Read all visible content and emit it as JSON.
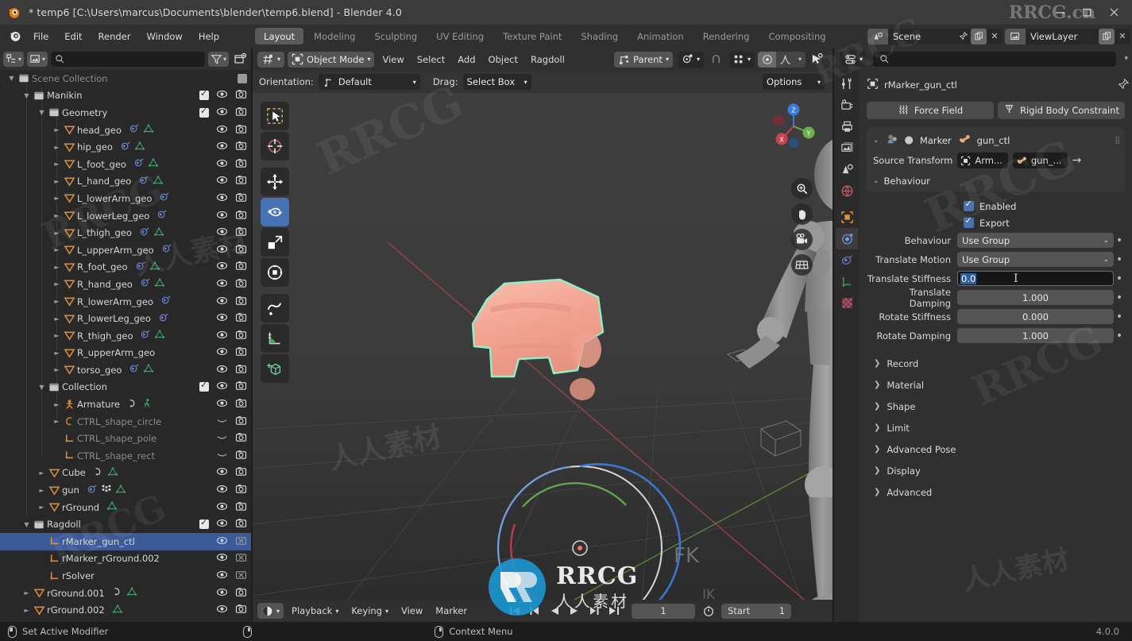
{
  "window": {
    "title": "* temp6 [C:\\Users\\marcus\\Documents\\blender\\temp6.blend] - Blender 4.0",
    "minimize": "–",
    "maximize": "□",
    "close": "✕"
  },
  "menubar": {
    "items": [
      "File",
      "Edit",
      "Render",
      "Window",
      "Help"
    ],
    "workspaces": [
      {
        "label": "Layout",
        "active": true
      },
      {
        "label": "Modeling",
        "active": false
      },
      {
        "label": "Sculpting",
        "active": false
      },
      {
        "label": "UV Editing",
        "active": false
      },
      {
        "label": "Texture Paint",
        "active": false
      },
      {
        "label": "Shading",
        "active": false
      },
      {
        "label": "Animation",
        "active": false
      },
      {
        "label": "Rendering",
        "active": false
      },
      {
        "label": "Compositing",
        "active": false
      }
    ],
    "scene_name": "Scene",
    "viewlayer_name": "ViewLayer"
  },
  "outliner": {
    "display_mode": "view-layer-icon",
    "filter_icon": "filter-icon",
    "new_collection_icon": "new-collection-icon",
    "search_placeholder": "",
    "rows": [
      {
        "label": "Scene Collection",
        "indent": 0,
        "icon": "collection",
        "tri": "down",
        "dim": true,
        "check": false,
        "eye": false,
        "cam": false,
        "partial": true
      },
      {
        "label": "Manikin",
        "indent": 1,
        "icon": "collection",
        "tri": "down",
        "check": true,
        "eye": true,
        "cam": true
      },
      {
        "label": "Geometry",
        "indent": 2,
        "icon": "collection",
        "tri": "down",
        "check": true,
        "eye": true,
        "cam": true
      },
      {
        "label": "head_geo",
        "indent": 3,
        "icon": "mesh",
        "tri": "right",
        "mods": [
          "modifier",
          "mesh-data"
        ],
        "eye": true,
        "cam": true
      },
      {
        "label": "hip_geo",
        "indent": 3,
        "icon": "mesh",
        "tri": "right",
        "mods": [
          "modifier",
          "mesh-data"
        ],
        "eye": true,
        "cam": true
      },
      {
        "label": "L_foot_geo",
        "indent": 3,
        "icon": "mesh",
        "tri": "right",
        "mods": [
          "modifier",
          "mesh-data"
        ],
        "eye": true,
        "cam": true
      },
      {
        "label": "L_hand_geo",
        "indent": 3,
        "icon": "mesh",
        "tri": "right",
        "mods": [
          "modifier",
          "mesh-data"
        ],
        "eye": true,
        "cam": true
      },
      {
        "label": "L_lowerArm_geo",
        "indent": 3,
        "icon": "mesh",
        "tri": "right",
        "mods": [
          "modifier"
        ],
        "eye": true,
        "cam": true
      },
      {
        "label": "L_lowerLeg_geo",
        "indent": 3,
        "icon": "mesh",
        "tri": "right",
        "mods": [
          "modifier"
        ],
        "eye": true,
        "cam": true
      },
      {
        "label": "L_thigh_geo",
        "indent": 3,
        "icon": "mesh",
        "tri": "right",
        "mods": [
          "modifier",
          "mesh-data"
        ],
        "eye": true,
        "cam": true
      },
      {
        "label": "L_upperArm_geo",
        "indent": 3,
        "icon": "mesh",
        "tri": "right",
        "mods": [
          "modifier"
        ],
        "eye": true,
        "cam": true
      },
      {
        "label": "R_foot_geo",
        "indent": 3,
        "icon": "mesh",
        "tri": "right",
        "mods": [
          "modifier",
          "mesh-data"
        ],
        "eye": true,
        "cam": true
      },
      {
        "label": "R_hand_geo",
        "indent": 3,
        "icon": "mesh",
        "tri": "right",
        "mods": [
          "modifier",
          "mesh-data"
        ],
        "eye": true,
        "cam": true
      },
      {
        "label": "R_lowerArm_geo",
        "indent": 3,
        "icon": "mesh",
        "tri": "right",
        "mods": [
          "modifier"
        ],
        "eye": true,
        "cam": true
      },
      {
        "label": "R_lowerLeg_geo",
        "indent": 3,
        "icon": "mesh",
        "tri": "right",
        "mods": [
          "modifier"
        ],
        "eye": true,
        "cam": true
      },
      {
        "label": "R_thigh_geo",
        "indent": 3,
        "icon": "mesh",
        "tri": "right",
        "mods": [
          "modifier",
          "mesh-data"
        ],
        "eye": true,
        "cam": true
      },
      {
        "label": "R_upperArm_geo",
        "indent": 3,
        "icon": "mesh",
        "tri": "right",
        "mods": [],
        "eye": true,
        "cam": true
      },
      {
        "label": "torso_geo",
        "indent": 3,
        "icon": "mesh",
        "tri": "right",
        "mods": [
          "modifier",
          "mesh-data"
        ],
        "eye": true,
        "cam": true
      },
      {
        "label": "Collection",
        "indent": 2,
        "icon": "collection",
        "tri": "down",
        "check": true,
        "eye": true,
        "cam": true
      },
      {
        "label": "Armature",
        "indent": 3,
        "icon": "armature",
        "tri": "right",
        "mods": [
          "anim",
          "pose"
        ],
        "eye": true,
        "cam": true
      },
      {
        "label": "CTRL_shape_circle",
        "indent": 3,
        "icon": "curve",
        "tri": "right",
        "dim": true,
        "curveEye": true,
        "cam": true
      },
      {
        "label": "CTRL_shape_pole",
        "indent": 3,
        "icon": "empty",
        "tri": "none",
        "dim": true,
        "curveEye": true,
        "cam": true
      },
      {
        "label": "CTRL_shape_rect",
        "indent": 3,
        "icon": "empty",
        "tri": "none",
        "dim": true,
        "curveEye": true,
        "cam": true
      },
      {
        "label": "Cube",
        "indent": 2,
        "icon": "mesh",
        "tri": "right",
        "mods": [
          "anim",
          "mesh-data"
        ],
        "eye": true,
        "cam": true
      },
      {
        "label": "gun",
        "indent": 2,
        "icon": "mesh",
        "tri": "right",
        "mods": [
          "modifier",
          "vertexgroup",
          "mesh-data"
        ],
        "eye": true,
        "cam": true
      },
      {
        "label": "rGround",
        "indent": 2,
        "icon": "mesh",
        "tri": "right",
        "mods": [
          "mesh-data"
        ],
        "eye": true,
        "cam": true
      },
      {
        "label": "Ragdoll",
        "indent": 1,
        "icon": "collection",
        "tri": "down",
        "check": true,
        "eye": true,
        "cam": true
      },
      {
        "label": "rMarker_gun_ctl",
        "indent": 2,
        "icon": "empty",
        "tri": "none",
        "selected": true,
        "eye": true,
        "camOff": true
      },
      {
        "label": "rMarker_rGround.002",
        "indent": 2,
        "icon": "empty",
        "tri": "none",
        "eye": true,
        "camOff": true
      },
      {
        "label": "rSolver",
        "indent": 2,
        "icon": "empty",
        "tri": "none",
        "eye": true,
        "camOff": true
      },
      {
        "label": "rGround.001",
        "indent": 1,
        "icon": "mesh",
        "tri": "right",
        "mods": [
          "anim",
          "mesh-data"
        ],
        "eye": true,
        "cam": true
      },
      {
        "label": "rGround.002",
        "indent": 1,
        "icon": "mesh",
        "tri": "right",
        "mods": [
          "mesh-data"
        ],
        "eye": true,
        "cam": true
      }
    ]
  },
  "viewport": {
    "mode": "Object Mode",
    "menus": [
      "View",
      "Select",
      "Add",
      "Object",
      "Ragdoll"
    ],
    "snap_parent_label": "Parent",
    "orientation_label": "Orientation:",
    "orientation_value": "Default",
    "drag_label": "Drag:",
    "drag_value": "Select Box",
    "options_label": "Options",
    "tools": [
      {
        "name": "tweak-select-box-tool",
        "active": false
      },
      {
        "name": "cursor-tool",
        "active": false
      },
      {
        "name": "move-tool",
        "active": false
      },
      {
        "name": "rotate-tool",
        "active": true
      },
      {
        "name": "scale-tool",
        "active": false
      },
      {
        "name": "transform-tool",
        "active": false
      },
      {
        "name": "annotate-tool",
        "active": false
      },
      {
        "name": "measure-tool",
        "active": false
      },
      {
        "name": "add-cube-tool",
        "active": false
      }
    ],
    "gizmo_axes": [
      "X",
      "Y",
      "Z"
    ],
    "nav_buttons": [
      "zoom-icon",
      "hand-icon",
      "camera-icon",
      "grid-icon"
    ],
    "selected_object_color": "#f5a898",
    "selection_outline_color": "#8ff0c8"
  },
  "properties": {
    "search_placeholder": "",
    "breadcrumb_object": "rMarker_gun_ctl",
    "pin_icon": "pin-icon",
    "tabs": [
      {
        "name": "tool",
        "active": false
      },
      {
        "name": "render",
        "active": false
      },
      {
        "name": "output",
        "active": false
      },
      {
        "name": "view-layer",
        "active": false
      },
      {
        "name": "scene",
        "active": false
      },
      {
        "name": "world",
        "active": false
      },
      {
        "name": "object",
        "active": false
      },
      {
        "name": "physics",
        "active": true
      },
      {
        "name": "constraints",
        "active": false
      },
      {
        "name": "object-data",
        "active": false
      },
      {
        "name": "material",
        "active": false
      }
    ],
    "sub_tabs": [
      {
        "label": "Force Field",
        "icon": "force-field-icon"
      },
      {
        "label": "Rigid Body Constraint",
        "icon": "rigid-body-constraint-icon"
      }
    ],
    "marker_panel": {
      "icon": "ragdoll-marker-icon",
      "type_label": "Marker",
      "name": "gun_ctl",
      "source_transform_label": "Source Transform",
      "source_object": "Arm...",
      "source_bone": "gun_...",
      "arrow": "→"
    },
    "behaviour_section": {
      "title": "Behaviour",
      "checkboxes": [
        {
          "label": "Enabled",
          "checked": true
        },
        {
          "label": "Export",
          "checked": true
        }
      ],
      "fields": [
        {
          "label": "Behaviour",
          "value": "Use Group",
          "kind": "dropdown"
        },
        {
          "label": "Translate Motion",
          "value": "Use Group",
          "kind": "dropdown"
        },
        {
          "label": "Translate Stiffness",
          "value": "0.0",
          "kind": "editing"
        },
        {
          "label": "Translate Damping",
          "value": "1.000",
          "kind": "slider"
        },
        {
          "label": "Rotate Stiffness",
          "value": "0.000",
          "kind": "slider"
        },
        {
          "label": "Rotate Damping",
          "value": "1.000",
          "kind": "slider"
        }
      ]
    },
    "collapsed_sections": [
      "Record",
      "Material",
      "Shape",
      "Limit",
      "Advanced Pose",
      "Display",
      "Advanced"
    ]
  },
  "timeline": {
    "menus": [
      "Playback",
      "Keying",
      "View",
      "Marker"
    ],
    "current_frame": "1",
    "start_label": "Start",
    "start_value": "1"
  },
  "statusbar": {
    "left_text": "Set Active Modifier",
    "center_text": "Context Menu",
    "version": "4.0.0"
  },
  "watermarks": {
    "title_bar": "RRCG.cn",
    "main_1": "RRCG",
    "main_2": "RRCG",
    "main_3": "RRCG",
    "cn_1": "人人素材",
    "cn_2": "人人素材",
    "cn_3": "人人素材",
    "logo_text": "RRCG",
    "logo_sub": "人人素材"
  }
}
